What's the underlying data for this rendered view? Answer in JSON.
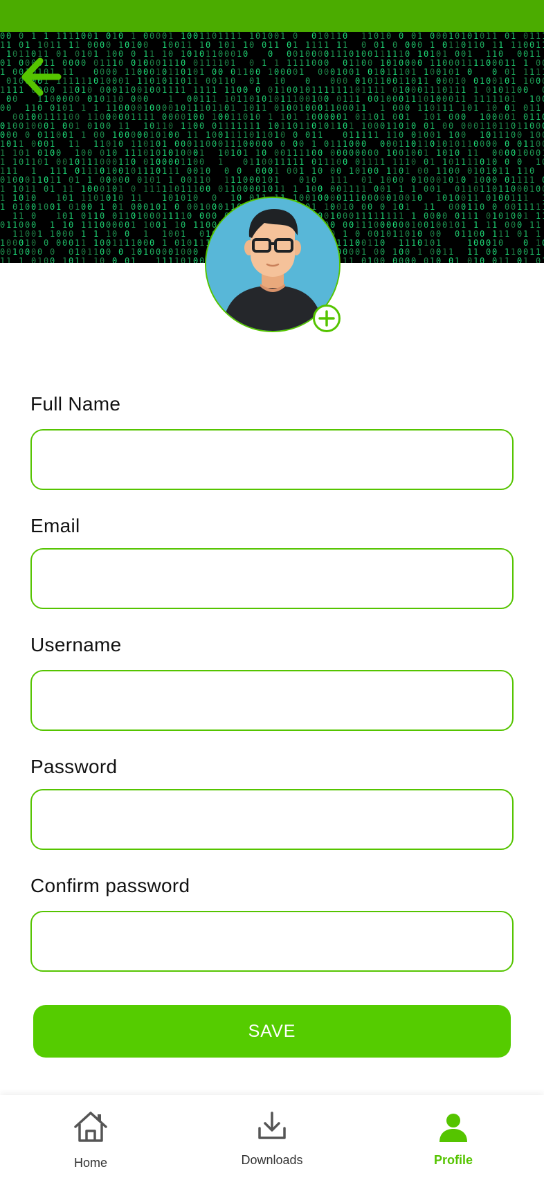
{
  "header": {
    "back_icon": "arrow-left-icon",
    "banner_pattern": "binary-matrix",
    "accent_color": "#55c400",
    "status_bar_color": "#4bac00"
  },
  "profile": {
    "avatar_icon": "user-avatar-icon",
    "add_photo_icon": "plus-circle-icon"
  },
  "form": {
    "fields": [
      {
        "label": "Full Name",
        "value": "",
        "placeholder": ""
      },
      {
        "label": "Email",
        "value": "",
        "placeholder": ""
      },
      {
        "label": "Username",
        "value": "",
        "placeholder": ""
      },
      {
        "label": "Password",
        "value": "",
        "placeholder": ""
      },
      {
        "label": "Confirm password",
        "value": "",
        "placeholder": ""
      }
    ],
    "save_label": "SAVE",
    "save_color": "#55cc00"
  },
  "bottom_nav": {
    "items": [
      {
        "label": "Home",
        "icon": "home-icon",
        "active": false
      },
      {
        "label": "Downloads",
        "icon": "download-icon",
        "active": false
      },
      {
        "label": "Profile",
        "icon": "profile-icon",
        "active": true
      }
    ]
  }
}
